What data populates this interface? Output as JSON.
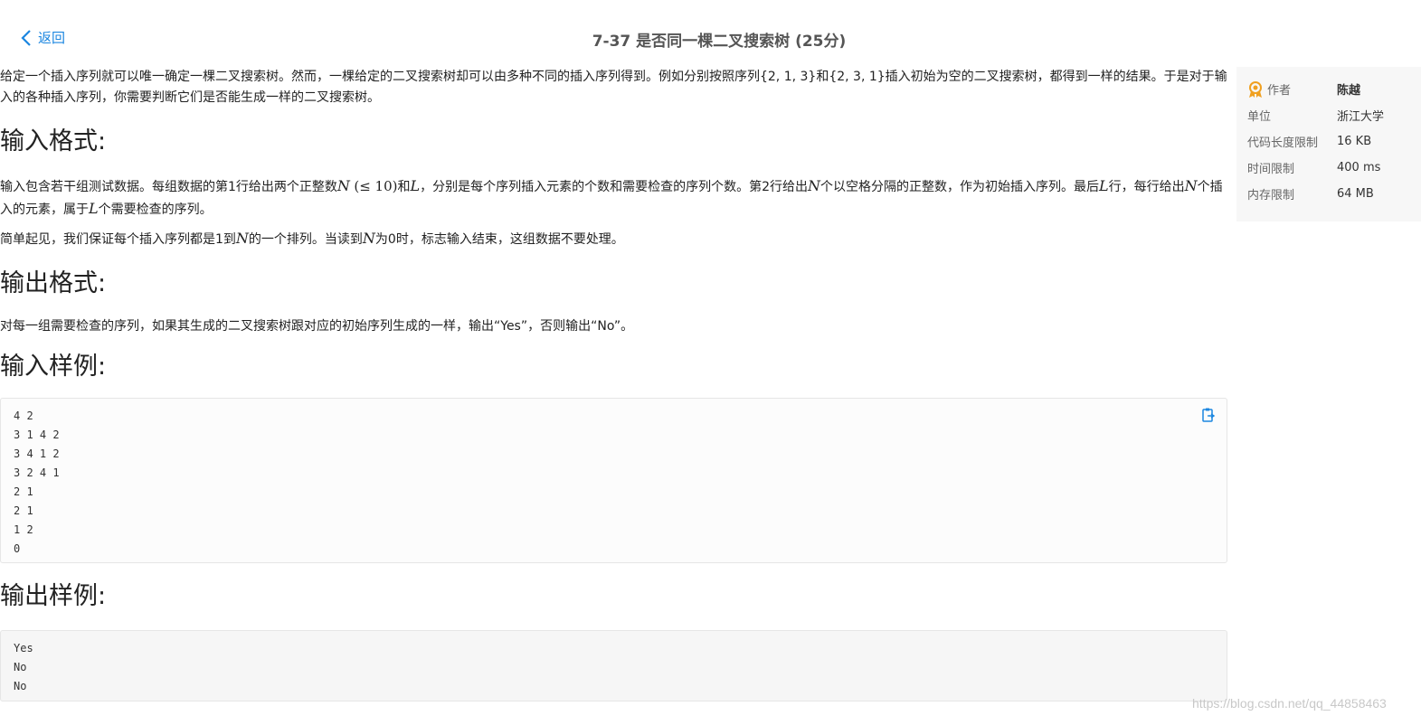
{
  "header": {
    "back_label": "返回",
    "title": "7-37 是否同一棵二叉搜索树 (25分)"
  },
  "intro": "给定一个插入序列就可以唯一确定一棵二叉搜索树。然而，一棵给定的二叉搜索树却可以由多种不同的插入序列得到。例如分别按照序列{2, 1, 3}和{2, 3, 1}插入初始为空的二叉搜索树，都得到一样的结果。于是对于输入的各种插入序列，你需要判断它们是否能生成一样的二叉搜索树。",
  "input_format": {
    "heading": "输入格式:",
    "p1": {
      "a": "输入包含若干组测试数据。每组数据的第1行给出两个正整数",
      "n1": "N",
      "cond": "(≤ 10)",
      "b": "和",
      "l1": "L",
      "c": "，分别是每个序列插入元素的个数和需要检查的序列个数。第2行给出",
      "n2": "N",
      "d": "个以空格分隔的正整数，作为初始插入序列。最后",
      "l2": "L",
      "e": "行，每行给出",
      "n3": "N",
      "f": "个插入的元素，属于",
      "l3": "L",
      "g": "个需要检查的序列。"
    },
    "p2": {
      "a": "简单起见，我们保证每个插入序列都是1到",
      "n": "N",
      "b": "的一个排列。当读到",
      "n2": "N",
      "c": "为0时，标志输入结束，这组数据不要处理。"
    }
  },
  "output_format": {
    "heading": "输出格式:",
    "text": "对每一组需要检查的序列，如果其生成的二叉搜索树跟对应的初始序列生成的一样，输出“Yes”，否则输出“No”。"
  },
  "sample_input": {
    "heading": "输入样例:",
    "lines": [
      "4 2",
      "3 1 4 2",
      "3 4 1 2",
      "3 2 4 1",
      "2 1",
      "2 1",
      "1 2",
      "0"
    ]
  },
  "sample_output": {
    "heading": "输出样例:",
    "lines": [
      "Yes",
      "No",
      "No"
    ]
  },
  "sidebar": {
    "author_label": "作者",
    "author": "陈越",
    "unit_label": "单位",
    "unit": "浙江大学",
    "code_limit_label": "代码长度限制",
    "code_limit": "16 KB",
    "time_limit_label": "时间限制",
    "time_limit": "400 ms",
    "memory_limit_label": "内存限制",
    "memory_limit": "64 MB"
  },
  "watermark": "https://blog.csdn.net/qq_44858463",
  "colors": {
    "link": "#1b86e0",
    "award_icon": "#f0a020"
  }
}
